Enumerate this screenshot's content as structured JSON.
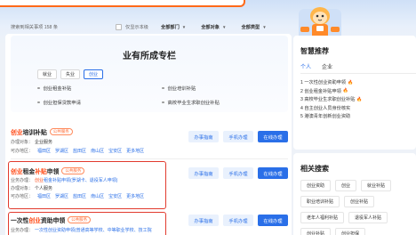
{
  "filters": {
    "result_count": "搜索到相关事项 158 条",
    "checkbox_label": "仅显示本级",
    "dept": "全部部门",
    "target": "全部对象",
    "type": "全部类型"
  },
  "zone": {
    "title": "业有所成专栏",
    "tabs": [
      {
        "label": "就业"
      },
      {
        "label": "失业"
      },
      {
        "label": "创业"
      }
    ],
    "links": [
      "创业租金补贴",
      "创业培训补贴",
      "创业担保贷款申请",
      "高校毕业生求职创业补贴"
    ]
  },
  "cards": [
    {
      "title_hl": "创业",
      "title_rest": "培训补贴",
      "badge": "公共服务",
      "line1_label": "办理对象：",
      "line1_value": "企业服务",
      "line2_label": "可办地区：",
      "districts": [
        "福田区",
        "罗湖区",
        "盐田区",
        "南山区",
        "宝安区",
        "更多地区"
      ]
    },
    {
      "title_hl": "创业",
      "title_mid": "租金",
      "title_hl2": "补贴",
      "title_rest": "申领",
      "badge": "公共服务",
      "line1_label": "业务办理：",
      "line1_prefix": "创业",
      "line1_rest": "租金补贴申领(罗湖卡、退役军人申领)",
      "line2_label": "办理对象：",
      "line2_value": "个人服务",
      "line3_label": "可办地区：",
      "districts": [
        "福田区",
        "罗湖区",
        "盐田区",
        "南山区",
        "宝安区",
        "更多地区"
      ]
    },
    {
      "title_pre": "一次性",
      "title_hl": "创业",
      "title_rest": "资助申领",
      "badge": "公共服务",
      "line1_label": "业务办理：",
      "line1_value": "一次性创业资助申领(普通高等学校、中等职业学校、技工院"
    }
  ],
  "buttons": {
    "guide": "办事指南",
    "mobile": "手机办理",
    "online": "在线办理"
  },
  "recommend": {
    "title": "智慧推荐",
    "tabs": [
      "个人",
      "企业"
    ],
    "items": [
      {
        "text": "1 一次性创业资助申领",
        "hot": true
      },
      {
        "text": "2 创业租金补贴申领",
        "hot": true
      },
      {
        "text": "3 高校毕业生求职创业补贴",
        "hot": true
      },
      {
        "text": "4 自主创业人员身份核实",
        "hot": false
      },
      {
        "text": "5 港澳青年创新创业资助",
        "hot": false
      }
    ]
  },
  "related": {
    "title": "相关搜索",
    "tags": [
      "创业资助",
      "创业",
      "就业补贴",
      "职业培训补贴",
      "创业补贴",
      "老年人福利补贴",
      "退役军人补贴",
      "创业补贴",
      "创业担保"
    ]
  },
  "colors": {
    "primary": "#2a6fe8",
    "accent": "#ff4d1a",
    "highlight_box": "#e23b2e"
  }
}
